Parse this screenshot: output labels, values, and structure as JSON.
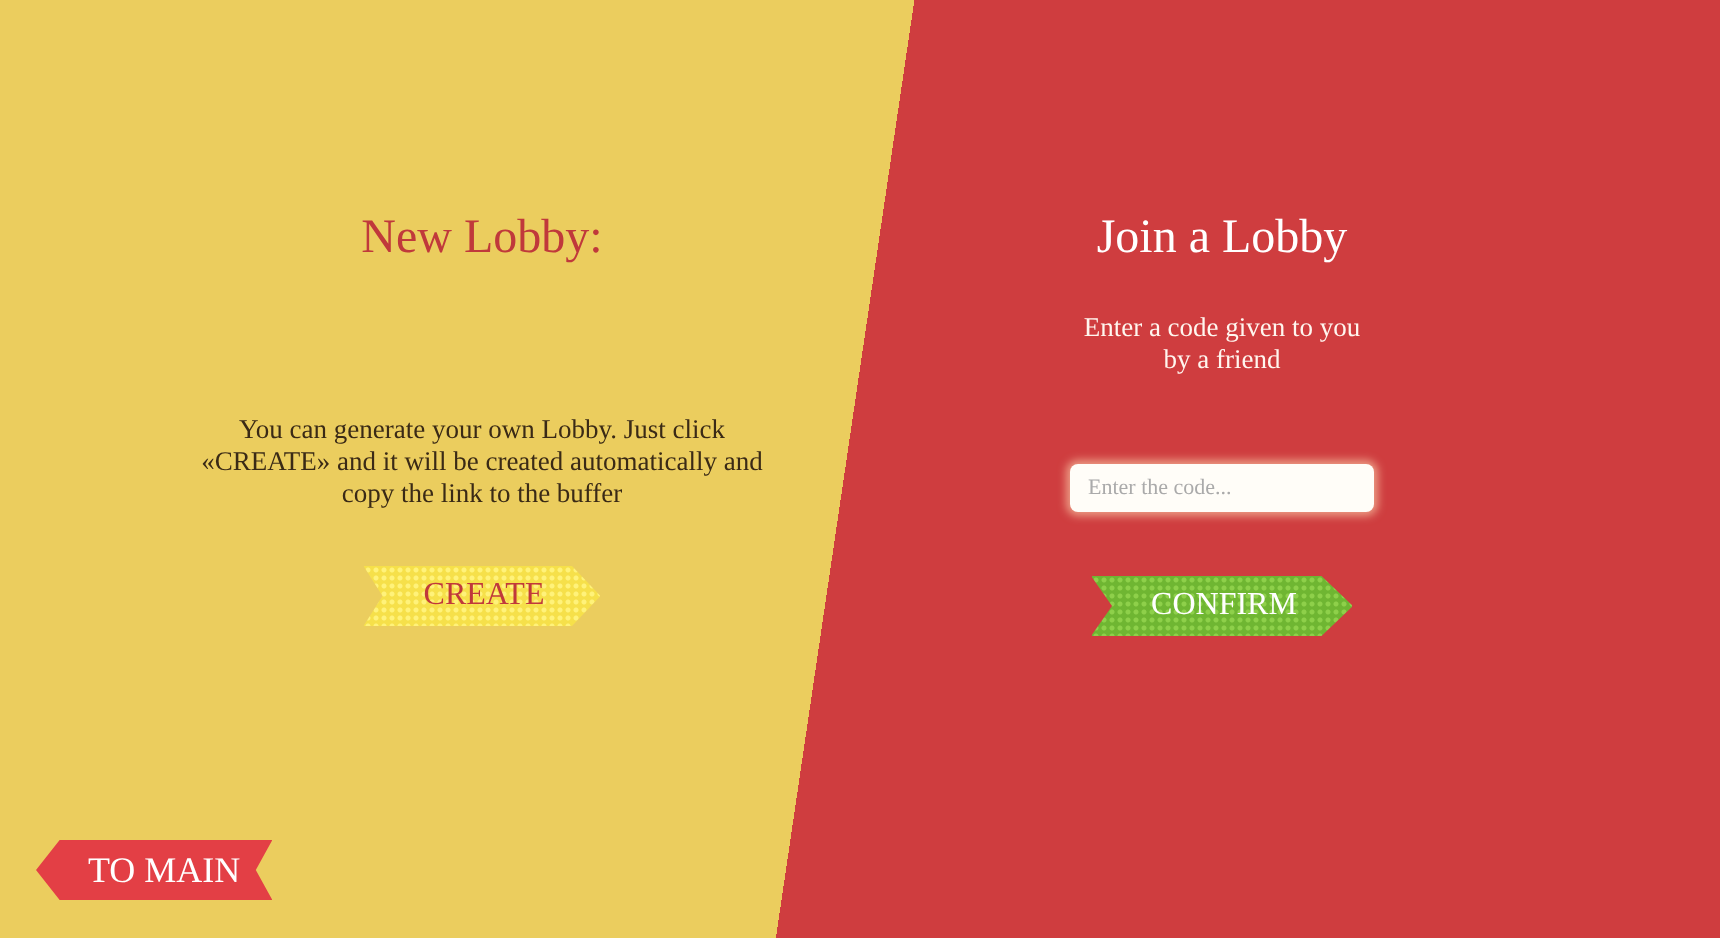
{
  "create_panel": {
    "title": "New Lobby:",
    "description": "You can generate your own Lobby. Just click «CREATE» and it will be created automatically and copy the link to the buffer",
    "button": "CREATE"
  },
  "join_panel": {
    "title": "Join a Lobby",
    "description": "Enter a code given to you by a friend",
    "code_field": {
      "placeholder": "Enter the code..."
    },
    "button": "CONFIRM"
  },
  "back_button": "TO MAIN"
}
